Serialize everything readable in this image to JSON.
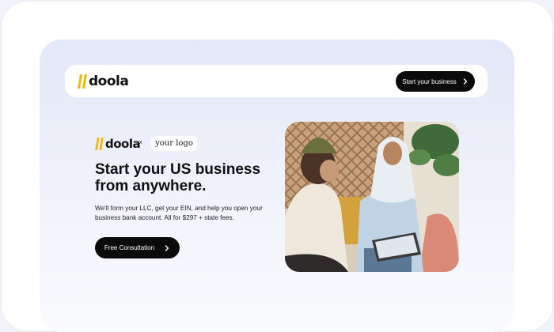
{
  "nav": {
    "brand_name": "doola",
    "cta_label": "Start your business"
  },
  "hero": {
    "brand_name": "doola",
    "separator": "x",
    "partner_logo_text": "your logo",
    "headline": "Start your US business from anywhere.",
    "subtext": "We'll form your LLC, get your EIN, and help you open your business bank account. All for $297 + state fees.",
    "cta_label": "Free Consultation"
  },
  "icons": {
    "brand_mark": "double-slash-logo-icon",
    "cta_arrow": "chevron-right-icon"
  },
  "colors": {
    "brand_accent": "#F2B705",
    "button_bg": "#0B0B0B",
    "text_primary": "#111111"
  }
}
